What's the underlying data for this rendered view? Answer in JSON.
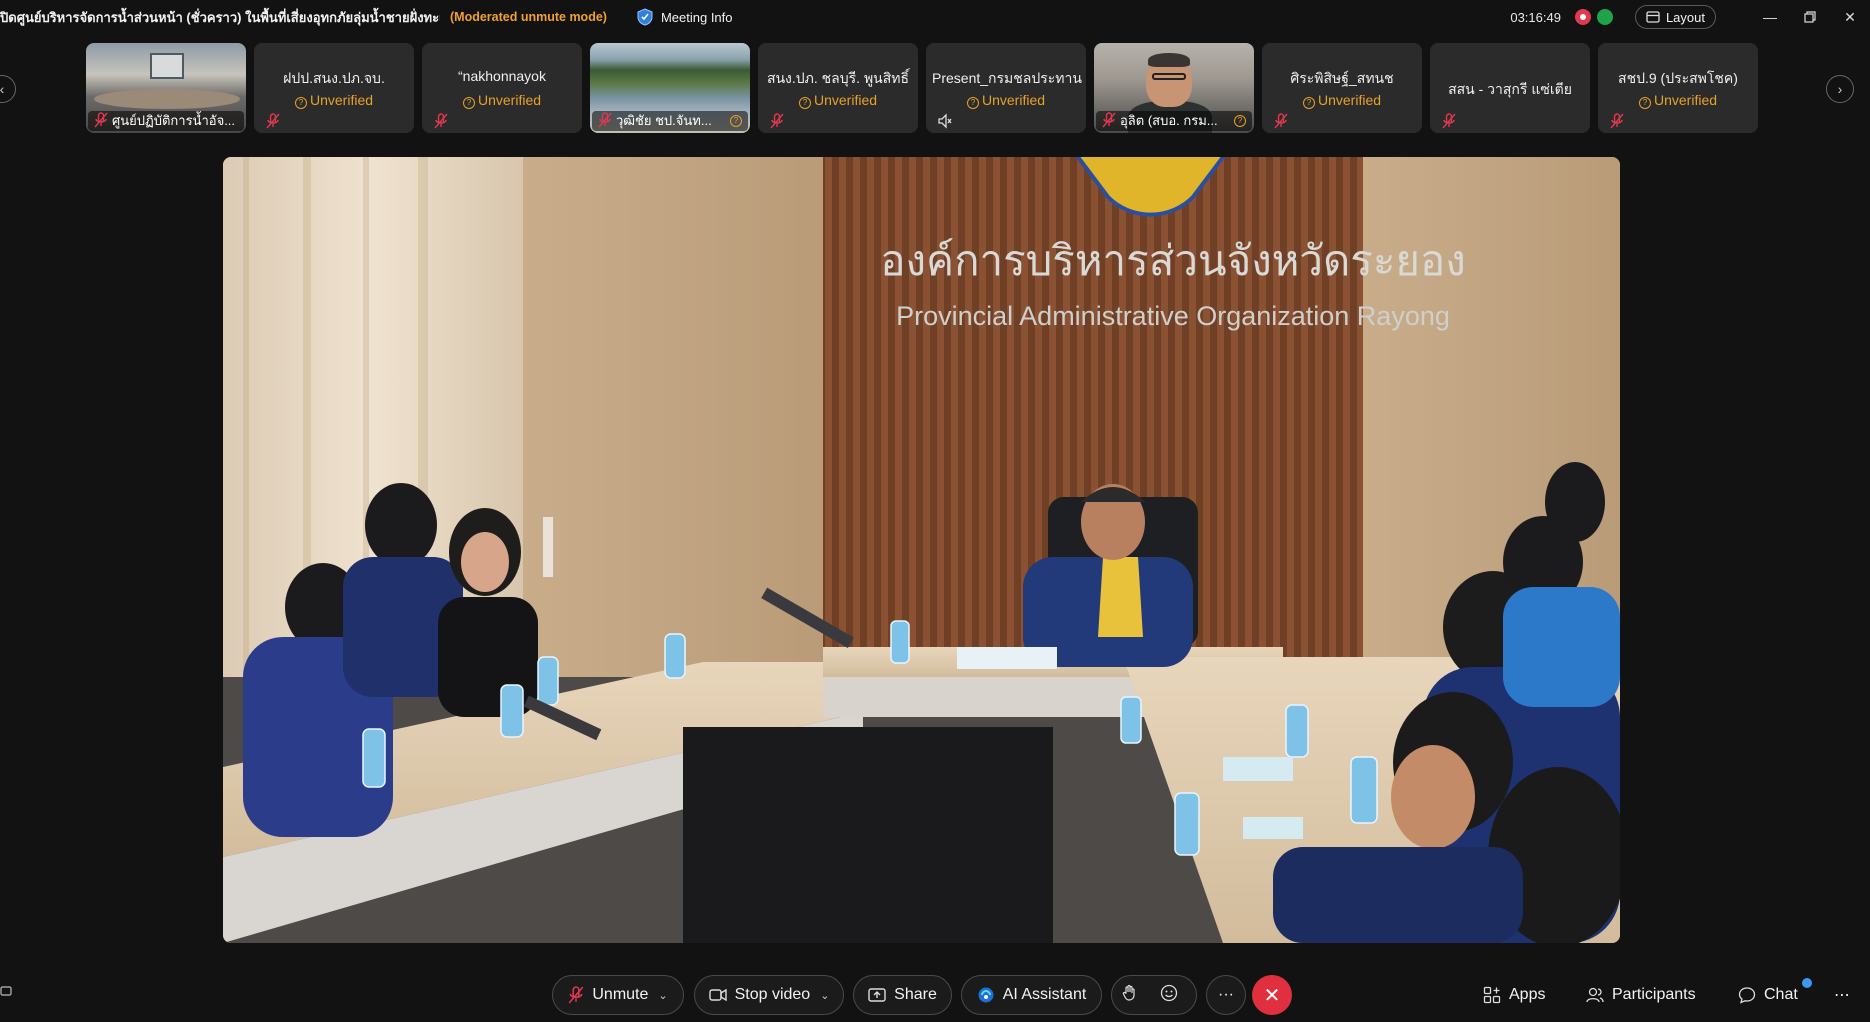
{
  "titlebar": {
    "title": "ปิดศูนย์บริหารจัดการน้ำส่วนหน้า (ชั่วคราว) ในพื้นที่เสี่ยงอุทกภัยลุ่มน้ำชายฝั่งทะเลตะวัน...",
    "mode": "(Moderated unmute mode)",
    "meeting_info": "Meeting Info",
    "clock": "03:16:49",
    "layout_label": "Layout"
  },
  "participants": [
    {
      "name": "ศูนย์ปฏิบัติการน้ำอัจ...",
      "kind": "video"
    },
    {
      "name": "ฝปป.สนง.ปภ.จบ.",
      "status": "Unverified",
      "kind": "avatar"
    },
    {
      "name": "“nakhonnayok",
      "status": "Unverified",
      "kind": "avatar"
    },
    {
      "name": "วุฒิชัย ชป.จันท...",
      "kind": "video"
    },
    {
      "name": "สนง.ปภ. ชลบุรี. พูนสิทธิ์",
      "status": "Unverified",
      "kind": "avatar"
    },
    {
      "name": "Present_กรมชลประทาน",
      "status": "Unverified",
      "kind": "avatar"
    },
    {
      "name": "อุลิต (สบอ. กรม...",
      "kind": "video"
    },
    {
      "name": "ศิระพิสิษฐ์_สทนช",
      "status": "Unverified",
      "kind": "avatar"
    },
    {
      "name": "สสน - วาสุกรี แซ่เตีย",
      "kind": "avatar"
    },
    {
      "name": "สชป.9 (ประสพโชค)",
      "status": "Unverified",
      "kind": "avatar"
    }
  ],
  "main_video": {
    "sign_thai": "องค์การบริหารส่วนจังหวัดระยอง",
    "sign_english": "Provincial Administrative Organization Rayong"
  },
  "toolbar": {
    "unmute": "Unmute",
    "stop_video": "Stop video",
    "share": "Share",
    "ai_assistant": "AI Assistant",
    "more": "···",
    "apps": "Apps",
    "participants": "Participants",
    "chat": "Chat",
    "overflow": "⋯"
  },
  "colors": {
    "accent_orange": "#e6a128",
    "end_red": "#e0303f",
    "recording_red": "#e0384f",
    "network_green": "#1fa34a"
  }
}
